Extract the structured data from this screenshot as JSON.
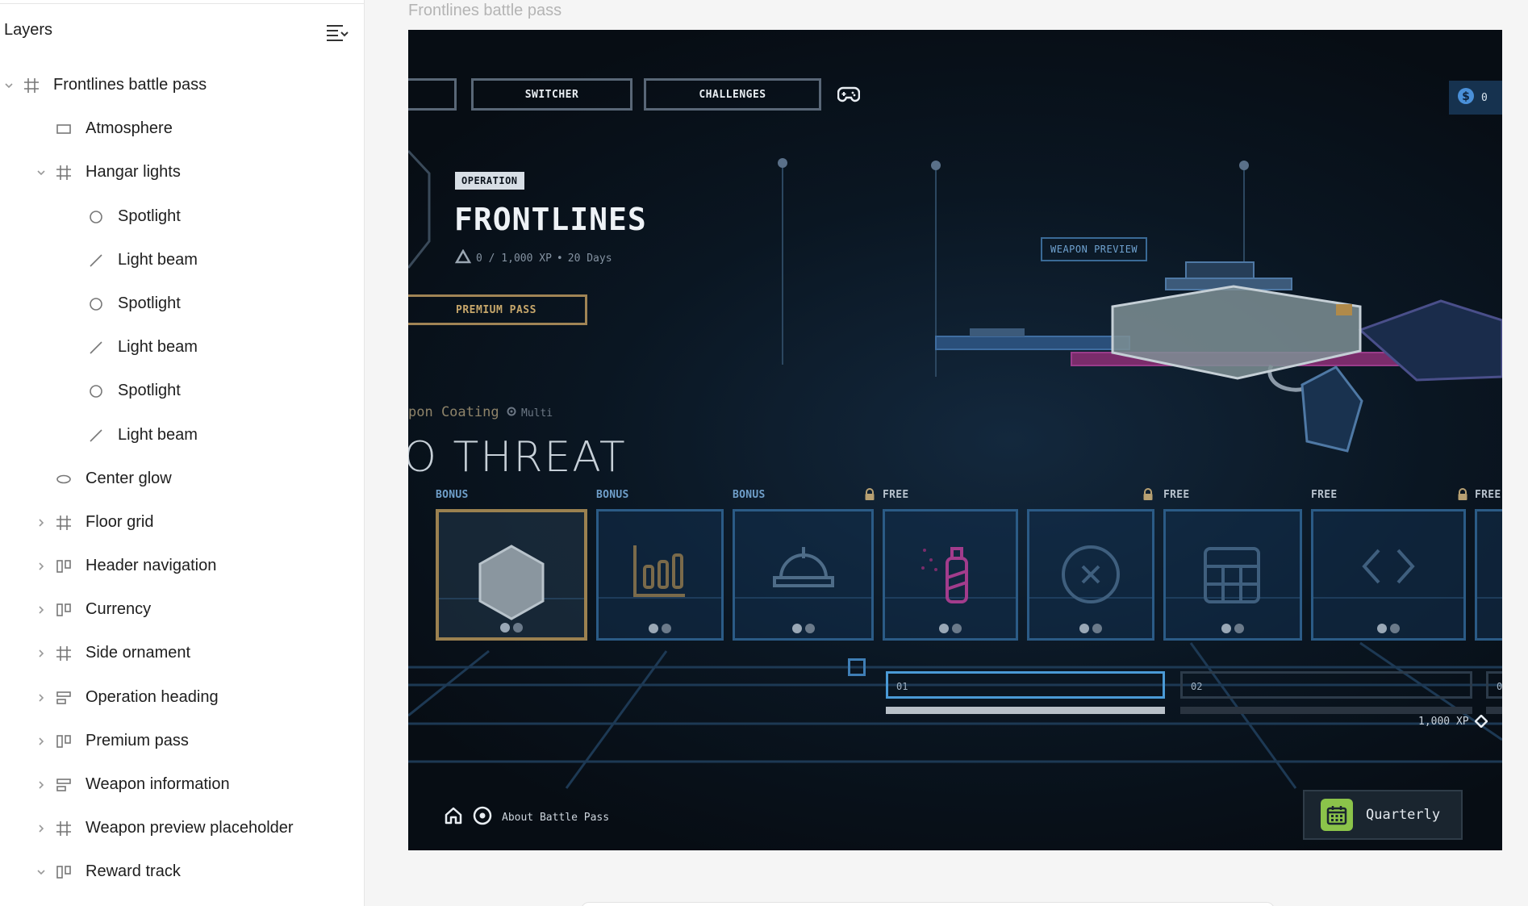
{
  "layers_panel": {
    "title": "Layers",
    "items": [
      {
        "label": "Frontlines battle pass",
        "type": "frame",
        "expanded": true,
        "depth": 0
      },
      {
        "label": "Atmosphere",
        "type": "rectangle",
        "depth": 1
      },
      {
        "label": "Hangar lights",
        "type": "frame",
        "expanded": true,
        "depth": 1
      },
      {
        "label": "Spotlight",
        "type": "ellipse",
        "depth": 2
      },
      {
        "label": "Light beam",
        "type": "line",
        "depth": 2
      },
      {
        "label": "Spotlight",
        "type": "ellipse",
        "depth": 2
      },
      {
        "label": "Light beam",
        "type": "line",
        "depth": 2
      },
      {
        "label": "Spotlight",
        "type": "ellipse",
        "depth": 2
      },
      {
        "label": "Light beam",
        "type": "line",
        "depth": 2
      },
      {
        "label": "Center glow",
        "type": "ellipse-flat",
        "depth": 1
      },
      {
        "label": "Floor grid",
        "type": "frame",
        "expanded": false,
        "depth": 1
      },
      {
        "label": "Header navigation",
        "type": "auto-layout-h",
        "expanded": false,
        "depth": 1
      },
      {
        "label": "Currency",
        "type": "auto-layout-h",
        "expanded": false,
        "depth": 1
      },
      {
        "label": "Side ornament",
        "type": "frame",
        "expanded": false,
        "depth": 1
      },
      {
        "label": "Operation heading",
        "type": "auto-layout-v",
        "expanded": false,
        "depth": 1
      },
      {
        "label": "Premium pass",
        "type": "auto-layout-h",
        "expanded": false,
        "depth": 1
      },
      {
        "label": "Weapon information",
        "type": "auto-layout-v",
        "expanded": false,
        "depth": 1
      },
      {
        "label": "Weapon preview placeholder",
        "type": "frame",
        "expanded": false,
        "depth": 1
      },
      {
        "label": "Reward track",
        "type": "auto-layout-h",
        "expanded": true,
        "depth": 1
      }
    ]
  },
  "canvas": {
    "frame_label": "Frontlines battle pass"
  },
  "game": {
    "nav": {
      "switcher": "SWITCHER",
      "challenges": "CHALLENGES"
    },
    "currency": {
      "value": "0"
    },
    "operation": {
      "badge": "OPERATION",
      "title": "FRONTLINES",
      "xp": "0 / 1,000 XP",
      "separator": "•",
      "days": "20 Days",
      "premium": "PREMIUM PASS"
    },
    "weapon": {
      "coating": "pon Coating",
      "multi": "Multi",
      "name": "O THREAT",
      "preview_tag": "WEAPON PREVIEW"
    },
    "rewards": [
      {
        "label": "BONUS",
        "kind": "bonus",
        "icon": "hexagon-icon",
        "selected": true,
        "locked": false
      },
      {
        "label": "BONUS",
        "kind": "bonus",
        "icon": "bar-chart-icon",
        "selected": false,
        "locked": false
      },
      {
        "label": "BONUS",
        "kind": "bonus",
        "icon": "helmet-icon",
        "selected": false,
        "locked": true
      },
      {
        "label": "FREE",
        "kind": "free",
        "icon": "spray-bottle-icon",
        "selected": false,
        "locked": false
      },
      {
        "label": "",
        "kind": "free",
        "icon": "x-circle-icon",
        "selected": false,
        "locked": true
      },
      {
        "label": "FREE",
        "kind": "free",
        "icon": "grid-icon",
        "selected": false,
        "locked": false
      },
      {
        "label": "FREE",
        "kind": "free",
        "icon": "code-icon",
        "selected": false,
        "locked": true
      },
      {
        "label": "FREE",
        "kind": "free",
        "icon": "",
        "selected": false,
        "locked": false
      }
    ],
    "levels": [
      {
        "label": "01",
        "progress": 1.0,
        "active": true
      },
      {
        "label": "02",
        "progress": 0.0,
        "active": false
      },
      {
        "label": "0",
        "progress": 0.0,
        "active": false
      }
    ],
    "xp_total": "1,000 XP",
    "footer": {
      "about": "About Battle Pass"
    },
    "quarterly": {
      "label": "Quarterly"
    },
    "colors": {
      "accent_blue": "#2b5b86",
      "gold": "#a08455",
      "calendar_green": "#8bc34a"
    }
  }
}
